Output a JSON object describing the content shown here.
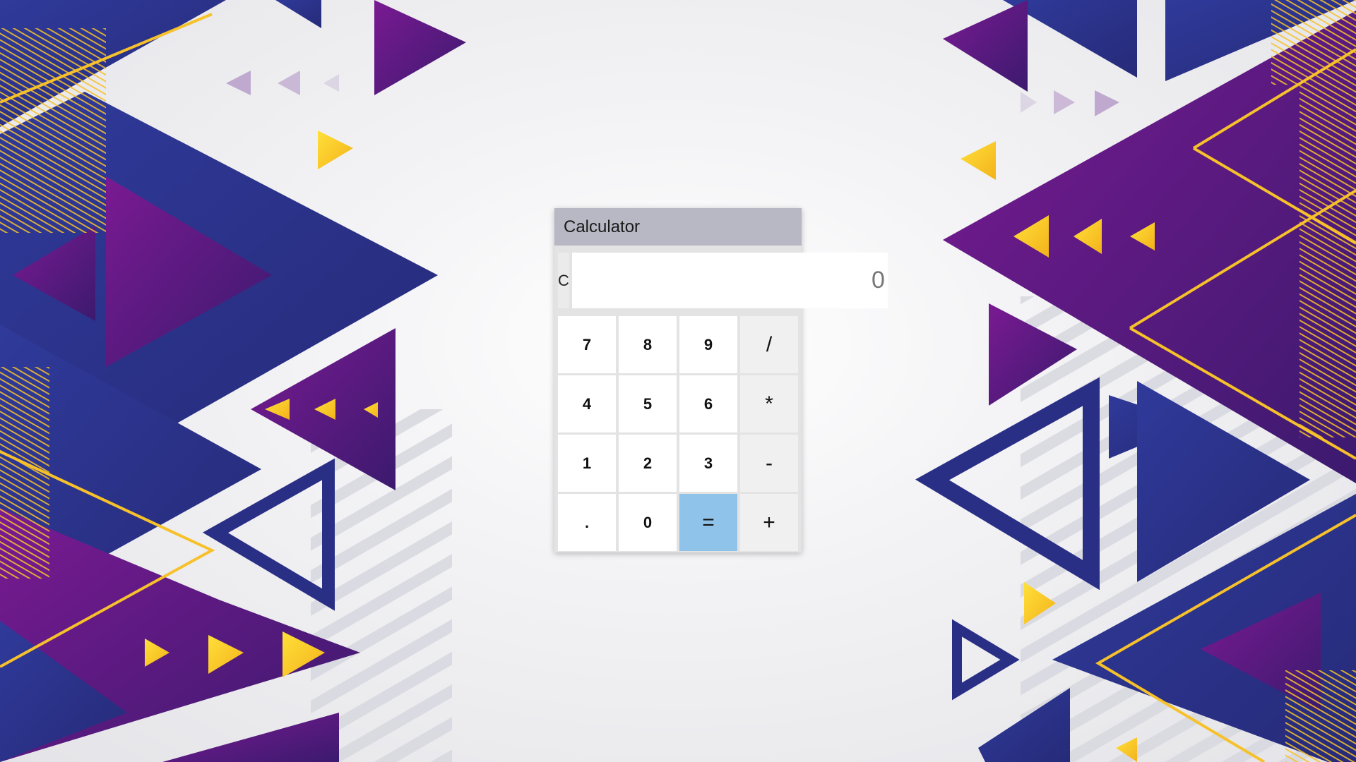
{
  "app": {
    "title": "Calculator"
  },
  "display": {
    "clear_label": "C",
    "value": "0"
  },
  "keys": [
    {
      "label": "7",
      "name": "key-7",
      "kind": "digit"
    },
    {
      "label": "8",
      "name": "key-8",
      "kind": "digit"
    },
    {
      "label": "9",
      "name": "key-9",
      "kind": "digit"
    },
    {
      "label": "/",
      "name": "divide-key",
      "kind": "op"
    },
    {
      "label": "4",
      "name": "key-4",
      "kind": "digit"
    },
    {
      "label": "5",
      "name": "key-5",
      "kind": "digit"
    },
    {
      "label": "6",
      "name": "key-6",
      "kind": "digit"
    },
    {
      "label": "*",
      "name": "multiply-key",
      "kind": "op"
    },
    {
      "label": "1",
      "name": "key-1",
      "kind": "digit"
    },
    {
      "label": "2",
      "name": "key-2",
      "kind": "digit"
    },
    {
      "label": "3",
      "name": "key-3",
      "kind": "digit"
    },
    {
      "label": "-",
      "name": "subtract-key",
      "kind": "op"
    },
    {
      "label": ".",
      "name": "decimal-key",
      "kind": "digit"
    },
    {
      "label": "0",
      "name": "key-0",
      "kind": "digit"
    },
    {
      "label": "=",
      "name": "equals-key",
      "kind": "equals"
    },
    {
      "label": "+",
      "name": "add-key",
      "kind": "op"
    }
  ],
  "colors": {
    "title_bar": "#b7b8c3",
    "equals_key": "#8fc3ea",
    "background_purple": "#6a1b8a",
    "background_navy": "#2a2f86",
    "background_yellow": "#f7c325"
  }
}
